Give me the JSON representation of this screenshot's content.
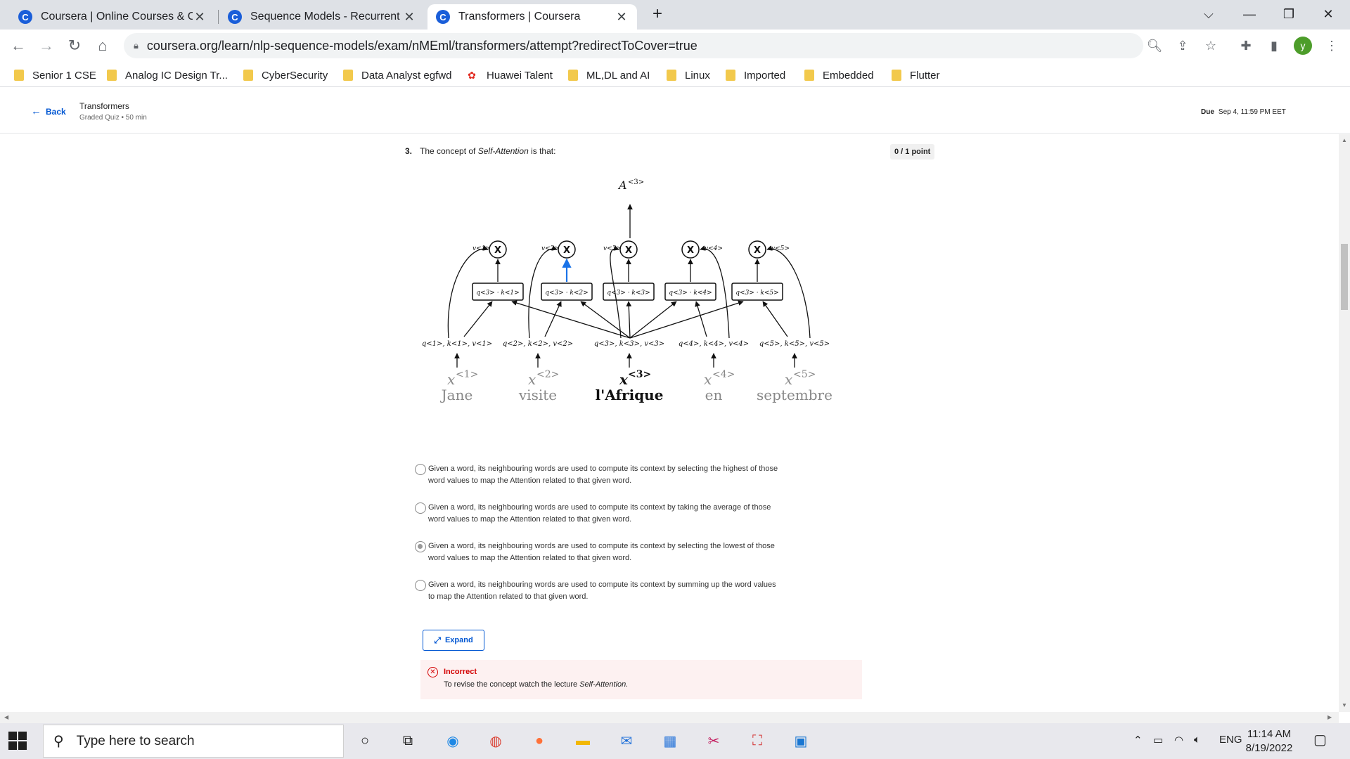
{
  "browser": {
    "tabs": [
      {
        "favicon": "C",
        "title": "Coursera | Online Courses & Crec",
        "active": false
      },
      {
        "favicon": "C",
        "title": "Sequence Models - Recurrent Ne",
        "active": false
      },
      {
        "favicon": "C",
        "title": "Transformers | Coursera",
        "active": true
      }
    ],
    "new_tab": "+",
    "url": "coursera.org/learn/nlp-sequence-models/exam/nMEml/transformers/attempt?redirectToCover=true",
    "profile_initial": "y",
    "bookmarks": [
      "Senior 1 CSE",
      "Analog IC Design Tr...",
      "CyberSecurity",
      "Data Analyst egfwd",
      "Huawei Talent",
      "ML,DL and AI",
      "Linux",
      "Imported",
      "Embedded",
      "Flutter"
    ]
  },
  "header": {
    "back_label": "Back",
    "title": "Transformers",
    "subtitle": "Graded Quiz • 50 min",
    "due_label": "Due",
    "due_date": "Sep 4, 11:59 PM EET"
  },
  "question": {
    "number": "3.",
    "text_prefix": "The concept of ",
    "text_emphasis": "Self-Attention",
    "text_suffix": " is that:",
    "points": "0 / 1 point",
    "figure": {
      "output": "A",
      "output_sup": "<3>",
      "words": [
        {
          "x_sup": "<1>",
          "word": "Jane",
          "qkv": "q<1>, k<1>, v<1>",
          "dot": "q<3> · k<1>",
          "v": "v<1>"
        },
        {
          "x_sup": "<2>",
          "word": "visite",
          "qkv": "q<2>, k<2>, v<2>",
          "dot": "q<3> · k<2>",
          "v": "v<2>"
        },
        {
          "x_sup": "<3>",
          "word": "l'Afrique",
          "qkv": "q<3>, k<3>, v<3>",
          "dot": "q<3> · k<3>",
          "v": "v<3>"
        },
        {
          "x_sup": "<4>",
          "word": "en",
          "qkv": "q<4>, k<4>, v<4>",
          "dot": "q<3> · k<4>",
          "v": "v<4>"
        },
        {
          "x_sup": "<5>",
          "word": "septembre",
          "qkv": "q<5>, k<5>, v<5>",
          "dot": "q<3> · k<5>",
          "v": "v<5>"
        }
      ],
      "x_letter": "x",
      "mult_symbol": "X"
    },
    "options": [
      {
        "text": "Given a word, its neighbouring words are used to compute its context by selecting the highest of those word values to map the Attention related to that given word.",
        "selected": false
      },
      {
        "text": "Given a word, its neighbouring words are used to compute its context by taking the average of those word values to map the Attention related to that given word.",
        "selected": false
      },
      {
        "text": "Given a word, its neighbouring words are used to compute its context by selecting the lowest of those word values to map the Attention related to that given word.",
        "selected": true
      },
      {
        "text": "Given a word, its neighbouring words are used to compute its context by summing up the word values to map the Attention related to that given word.",
        "selected": false
      }
    ],
    "expand_label": "Expand",
    "feedback": {
      "status": "Incorrect",
      "text_prefix": "To revise the concept watch the lecture ",
      "text_emphasis": "Self-Attention."
    }
  },
  "taskbar": {
    "search_placeholder": "Type here to search",
    "language": "ENG",
    "time": "11:14 AM",
    "date": "8/19/2022"
  },
  "colors": {
    "accent": "#0056d2",
    "error": "#d30001",
    "highlight_arrow": "#1a73e8"
  }
}
